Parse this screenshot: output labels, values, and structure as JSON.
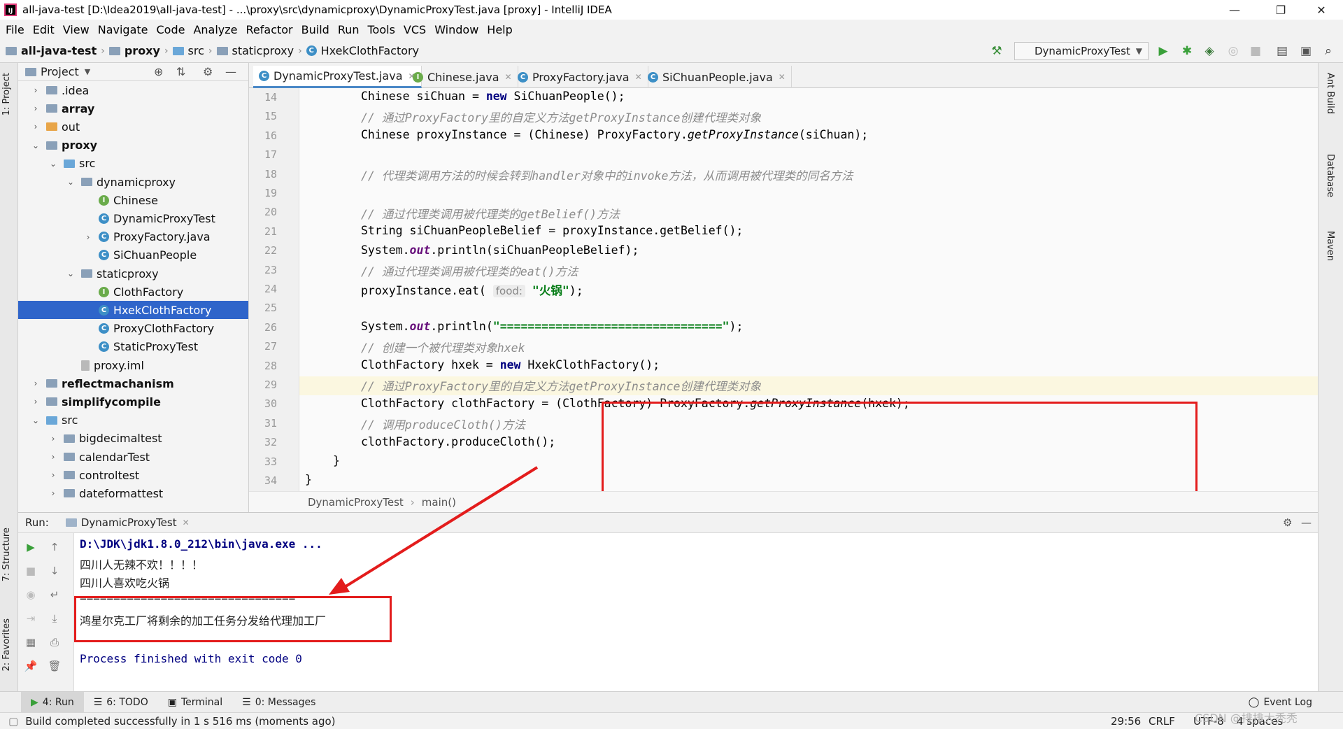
{
  "window": {
    "title": "all-java-test [D:\\Idea2019\\all-java-test] - ...\\proxy\\src\\dynamicproxy\\DynamicProxyTest.java [proxy] - IntelliJ IDEA",
    "minimize": "—",
    "restore": "❐",
    "close": "✕"
  },
  "menu": [
    "File",
    "Edit",
    "View",
    "Navigate",
    "Code",
    "Analyze",
    "Refactor",
    "Build",
    "Run",
    "Tools",
    "VCS",
    "Window",
    "Help"
  ],
  "nav": {
    "crumbs": [
      "all-java-test",
      "proxy",
      "src",
      "staticproxy",
      "HxekClothFactory"
    ],
    "run_config": "DynamicProxyTest"
  },
  "left_strip": {
    "project": "1: Project",
    "structure": "7: Structure",
    "favorites": "2: Favorites"
  },
  "right_strip": {
    "ant": "Ant Build",
    "database": "Database",
    "maven": "Maven"
  },
  "project_panel": {
    "title": "Project",
    "items": [
      {
        "label": ".idea",
        "bold": false
      },
      {
        "label": "array",
        "bold": true
      },
      {
        "label": "out",
        "bold": false
      },
      {
        "label": "proxy",
        "bold": true
      },
      {
        "label": "src",
        "bold": false
      },
      {
        "label": "dynamicproxy",
        "bold": false
      },
      {
        "label": "Chinese",
        "bold": false
      },
      {
        "label": "DynamicProxyTest",
        "bold": false
      },
      {
        "label": "ProxyFactory.java",
        "bold": false
      },
      {
        "label": "SiChuanPeople",
        "bold": false
      },
      {
        "label": "staticproxy",
        "bold": false
      },
      {
        "label": "ClothFactory",
        "bold": false
      },
      {
        "label": "HxekClothFactory",
        "bold": false
      },
      {
        "label": "ProxyClothFactory",
        "bold": false
      },
      {
        "label": "StaticProxyTest",
        "bold": false
      },
      {
        "label": "proxy.iml",
        "bold": false
      },
      {
        "label": "reflectmachanism",
        "bold": true
      },
      {
        "label": "simplifycompile",
        "bold": true
      },
      {
        "label": "src",
        "bold": false
      },
      {
        "label": "bigdecimaltest",
        "bold": false
      },
      {
        "label": "calendarTest",
        "bold": false
      },
      {
        "label": "controltest",
        "bold": false
      },
      {
        "label": "dateformattest",
        "bold": false
      }
    ]
  },
  "tabs": [
    "DynamicProxyTest.java",
    "Chinese.java",
    "ProxyFactory.java",
    "SiChuanPeople.java"
  ],
  "editor": {
    "line_numbers": [
      "14",
      "15",
      "16",
      "17",
      "18",
      "19",
      "20",
      "21",
      "22",
      "23",
      "24",
      "25",
      "26",
      "27",
      "28",
      "29",
      "30",
      "31",
      "32",
      "33",
      "34"
    ],
    "l14": "Chinese siChuan = ",
    "l14b": "new",
    "l14c": " SiChuanPeople();",
    "l15": "// 通过ProxyFactory里的自定义方法getProxyInstance创建代理类对象",
    "l16a": "Chinese proxyInstance = (Chinese) ProxyFactory.",
    "l16b": "getProxyInstance",
    "l16c": "(siChuan);",
    "l18": "// 代理类调用方法的时候会转到handler对象中的invoke方法，从而调用被代理类的同名方法",
    "l20": "// 通过代理类调用被代理类的getBelief()方法",
    "l21": "String siChuanPeopleBelief = proxyInstance.getBelief();",
    "l22a": "System.",
    "l22b": "out",
    "l22c": ".println(siChuanPeopleBelief);",
    "l23": "// 通过代理类调用被代理类的eat()方法",
    "l24a": "proxyInstance.eat( ",
    "l24hint": "food:",
    "l24str": "\"火锅\"",
    "l24c": ");",
    "l26a": "System.",
    "l26b": "out",
    "l26c": ".println(",
    "l26str": "\"================================\"",
    "l26d": ");",
    "l27": "// 创建一个被代理类对象hxek",
    "l28a": "ClothFactory hxek = ",
    "l28b": "new",
    "l28c": " HxekClothFactory();",
    "l29": "// 通过ProxyFactory里的自定义方法getProxyInstance创建代理类对象",
    "l30a": "ClothFactory clothFactory = (ClothFactory) ProxyFactory.",
    "l30b": "getProxyInstance",
    "l30c": "(hxek);",
    "l31": "// 调用produceCloth()方法",
    "l32": "clothFactory.produceCloth();",
    "l33": "}",
    "l34": "}"
  },
  "editor_breadcrumb": [
    "DynamicProxyTest",
    "main()"
  ],
  "run": {
    "label": "Run:",
    "tab": "DynamicProxyTest",
    "lines": [
      "D:\\JDK\\jdk1.8.0_212\\bin\\java.exe ...",
      "四川人无辣不欢！！！！",
      "四川人喜欢吃火锅",
      "================================",
      "鸿星尔克工厂将剩余的加工任务分发给代理加工厂",
      "Process finished with exit code 0"
    ]
  },
  "bottom_tabs": [
    "4: Run",
    "6: TODO",
    "Terminal",
    "0: Messages",
    "Event Log"
  ],
  "status": {
    "message": "Build completed successfully in 1 s 516 ms (moments ago)",
    "position": "29:56",
    "line_sep": "CRLF",
    "encoding": "UTF-8",
    "indent": "4 spaces",
    "watermark": "CSDN @排排大秃秃"
  },
  "colors": {
    "selection": "#2f65ca",
    "annotation_red": "#e31c1c",
    "keyword": "#000080",
    "comment": "#8c8c8c",
    "string": "#067d17"
  }
}
